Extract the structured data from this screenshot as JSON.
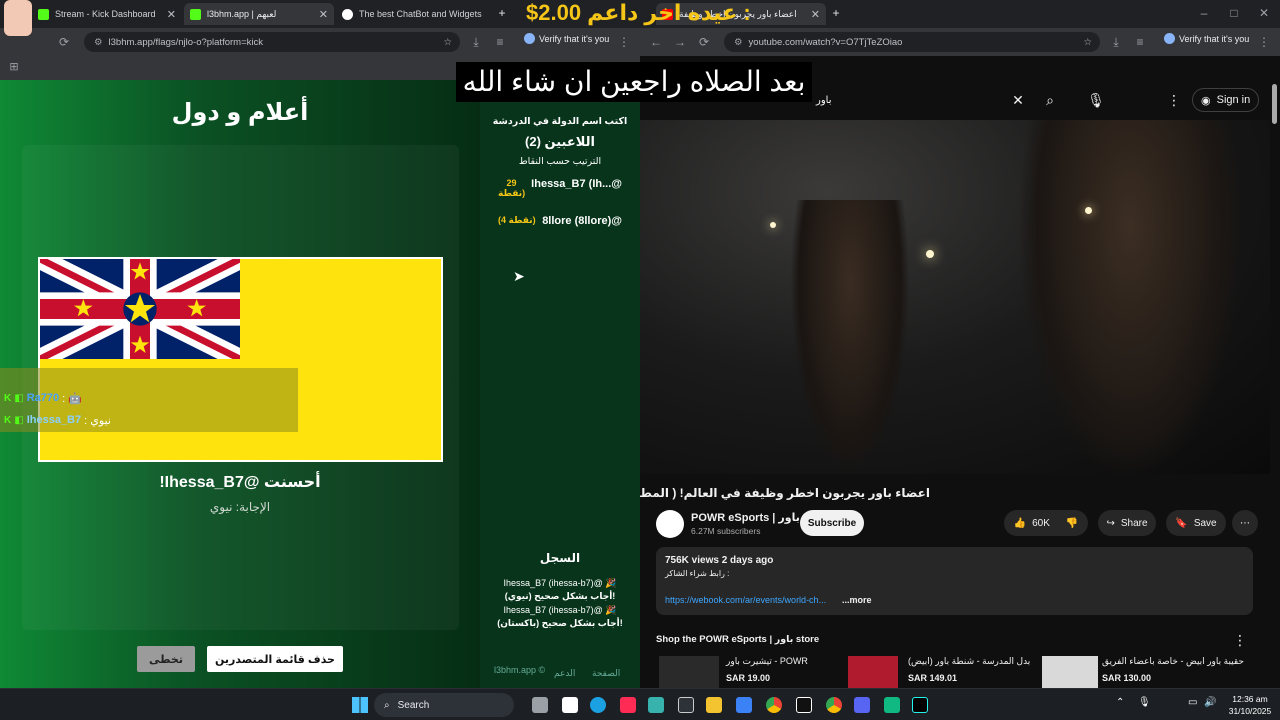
{
  "left_browser": {
    "tabs": [
      {
        "label": "Stream - Kick Dashboard",
        "color": "#53fc18",
        "active": false
      },
      {
        "label": "l3bhm.app | لعبهم",
        "color": "#53fc18",
        "active": true
      },
      {
        "label": "The best ChatBot and Widgets",
        "color": "#ffffff",
        "active": false
      }
    ],
    "url": "l3bhm.app/flags/njlo-o?platform=kick",
    "verify_label": "Verify that it's you"
  },
  "game": {
    "title": "أعلام و دول",
    "correct_message": "!Ihessa_B7@ أحسنت",
    "answer_message": "الإجابة: نيوي",
    "skip_button": "تخطى",
    "clear_button": "حذف قائمة المتصدرين",
    "chat": [
      {
        "user": "Ra770",
        "text": ": 🤖"
      },
      {
        "user": "Ihessa_B7",
        "text": ": نيوي"
      }
    ]
  },
  "leaderboard": {
    "instruction": "اكتب اسم الدولة في الدردشة",
    "players_heading": "اللاعبين (2)",
    "sort_label": "الترتيب حسب النقاط",
    "rows": [
      {
        "name": "Ihessa_B7 (Ih...@",
        "points": "29\nنقطة)"
      },
      {
        "name": "8llore (8llore)@",
        "points": "(4 نقطة)"
      }
    ],
    "log_heading": "السجل",
    "log": [
      "Ihessa_B7 (ihessa-b7)@ 🎉",
      "أجاب بشكل صحيح (نيوي)!",
      "Ihessa_B7 (ihessa-b7)@ 🎉",
      "أجاب بشكل صحيح (باكستان)!"
    ],
    "footer_left": "l3bhm.app ©",
    "footer_mid": "الدعم",
    "footer_right": "الصفحة"
  },
  "overlay": {
    "caption": "بعد الصلاه راجعين ان شاء الله",
    "donation": "$2.00 عيده اخر داعم :"
  },
  "right_browser": {
    "tab_label": "اعضاء باور يجربون اخطر وظيفة",
    "url": "youtube.com/watch?v=O7TjTeZOiao",
    "verify_label": "Verify that it's you",
    "search_query": "باور",
    "sign_in": "Sign in",
    "video_title": "اعضاء باور يجربون اخطر وظيفة في العالم! ( المطافي 🔥 ) 🇺🇸",
    "channel_name": "POWR eSports | باور",
    "subscribers": "6.27M subscribers",
    "subscribe": "Subscribe",
    "likes": "60K",
    "share": "Share",
    "save": "Save",
    "views": "756K views  2 days ago",
    "desc_line": "رابط شراء الشاكر :",
    "desc_link": "https://webook.com/ar/events/world-ch...",
    "more": "...more",
    "shop_heading": "Shop the POWR eSports | باور store",
    "shop": [
      {
        "name": "تيشيرت باور - POWR",
        "price": "SAR 19.00"
      },
      {
        "name": "بدل المدرسة - شنطة باور (ابيض)",
        "price": "SAR 149.01"
      },
      {
        "name": "حقيبة باور ابيض - خاصة باعضاء الفريق",
        "price": "SAR 130.00"
      }
    ]
  },
  "taskbar": {
    "search_label": "Search",
    "time": "12:36 am",
    "date": "31/10/2025"
  }
}
